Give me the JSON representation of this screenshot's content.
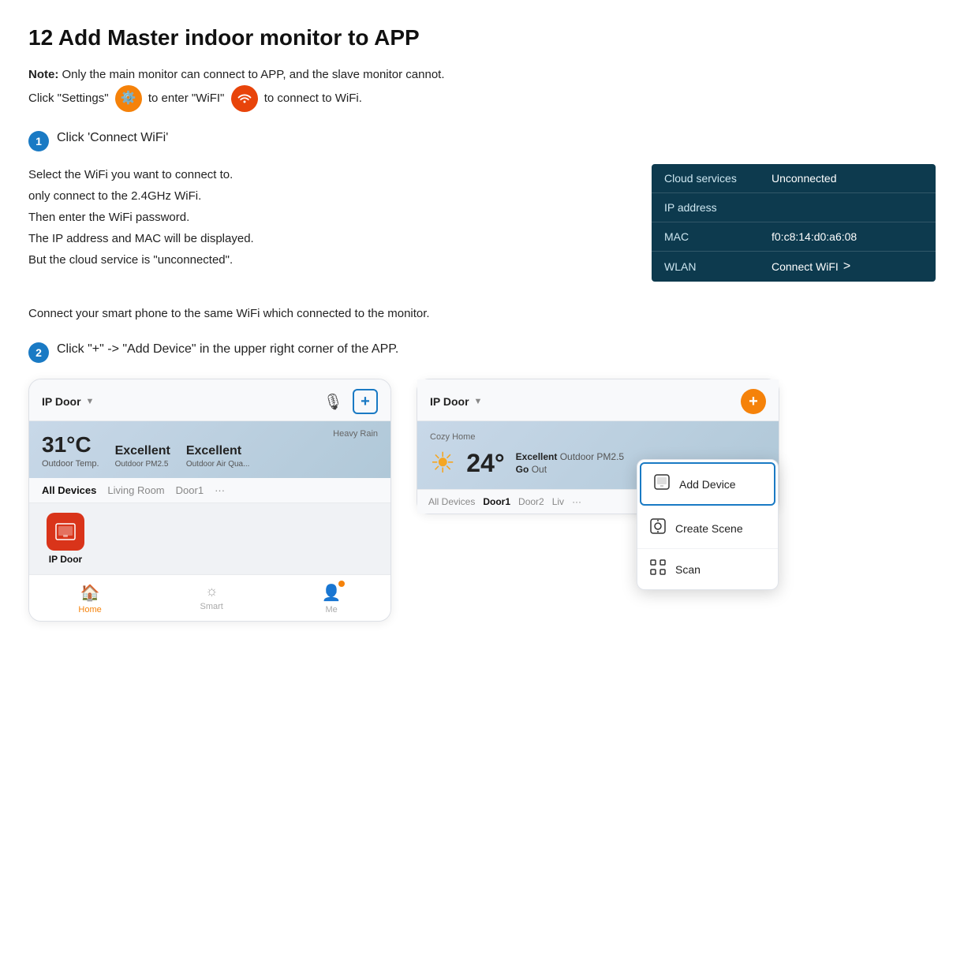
{
  "page": {
    "title": "12  Add Master indoor monitor to APP"
  },
  "note": {
    "prefix": "Note:",
    "text": "Only the main monitor can connect to APP,  and the slave monitor cannot.",
    "text2": "Click \"Settings\"",
    "text3": "to enter \"WiFI\"",
    "text4": "to connect to WiFi."
  },
  "step1": {
    "badge": "1",
    "label": "Click 'Connect WiFi'"
  },
  "step1_body": {
    "line1": "Select the WiFi you want to connect to.",
    "line2": "only connect to the 2.4GHz WiFi.",
    "line3": "Then enter the WiFi password.",
    "line4": "The IP address and MAC will be displayed.",
    "line5": "But the cloud service is \"unconnected\"."
  },
  "device_table": {
    "rows": [
      {
        "label": "Cloud services",
        "value": "Unconnected"
      },
      {
        "label": "IP address",
        "value": ""
      },
      {
        "label": "MAC",
        "value": "f0:c8:14:d0:a6:08"
      },
      {
        "label": "WLAN",
        "value": "Connect WiFI",
        "has_chevron": true
      }
    ]
  },
  "connect_phone_note": "Connect your smart phone to the same WiFi which connected to the monitor.",
  "step2": {
    "badge": "2",
    "label": "Click \"+\" -> \"Add Device\" in the upper right corner of the APP."
  },
  "phone_left": {
    "title": "IP Door",
    "weather_tag": "Heavy Rain",
    "temp": "31°C",
    "temp_label": "Outdoor Temp.",
    "stat1_val": "Excellent",
    "stat1_label": "Outdoor PM2.5",
    "stat2_val": "Excellent",
    "stat2_label": "Outdoor Air Qua...",
    "tabs": [
      "All Devices",
      "Living Room",
      "Door1",
      "..."
    ],
    "device_name": "IP Door",
    "nav": [
      "Home",
      "Smart",
      "Me"
    ]
  },
  "phone_right": {
    "title": "IP Door",
    "location": "Cozy Home",
    "temp": "24°",
    "stat1_val": "Excellent",
    "stat1_label": "Outdoor PM2.5",
    "stat2_val": "Go",
    "stat2_label": "Out",
    "bottom_tabs": [
      "All Devices",
      "Door1",
      "Door2",
      "Liv",
      "..."
    ],
    "menu_items": [
      {
        "label": "Add Device",
        "highlighted": true
      },
      {
        "label": "Create Scene",
        "highlighted": false
      },
      {
        "label": "Scan",
        "highlighted": false
      }
    ]
  },
  "icons": {
    "settings": "⚙",
    "wifi": "📶",
    "mic": "🎙",
    "plus": "+",
    "home": "🏠",
    "smart": "☼",
    "me": "👤",
    "sun": "☀",
    "device": "🖥",
    "add_device_icon": "⊡",
    "create_scene_icon": "⊞",
    "scan_icon": "⊟"
  }
}
